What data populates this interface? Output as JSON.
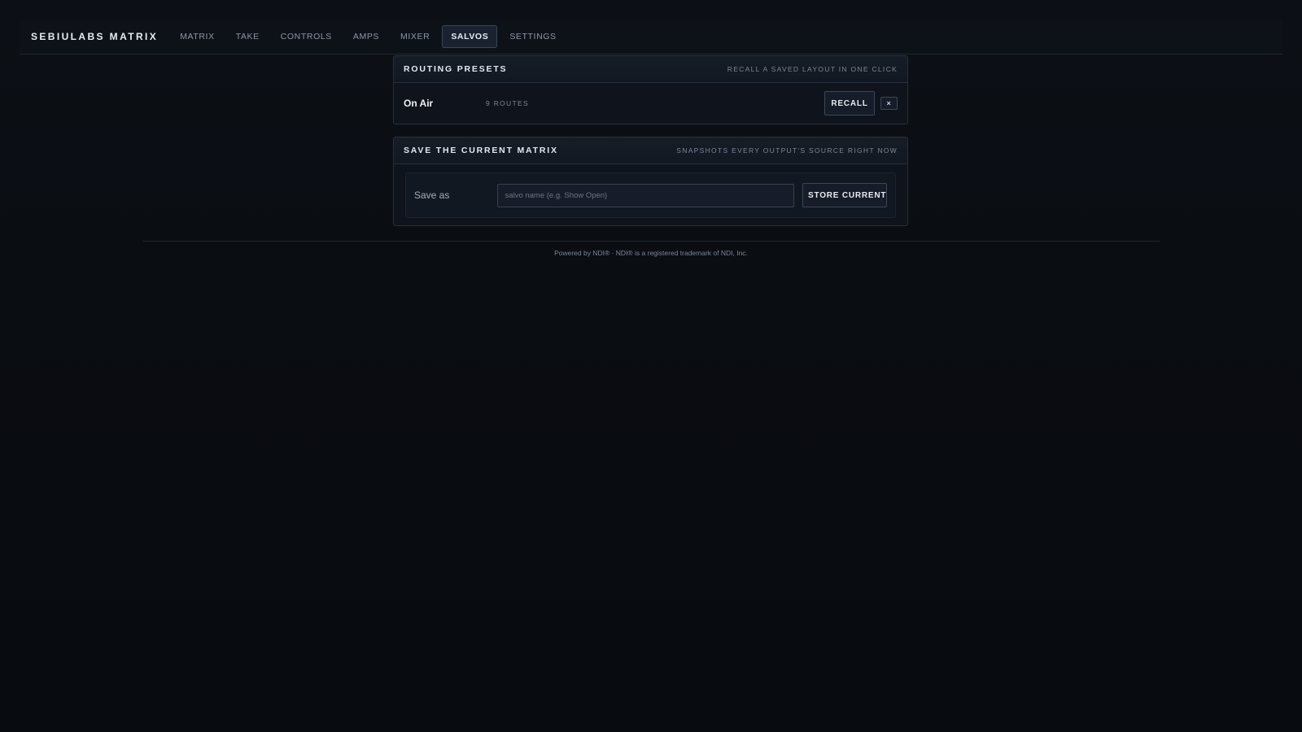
{
  "app": {
    "brand": "SEBIULABS MATRIX"
  },
  "nav": {
    "items": [
      {
        "label": "MATRIX",
        "active": false
      },
      {
        "label": "TAKE",
        "active": false
      },
      {
        "label": "CONTROLS",
        "active": false
      },
      {
        "label": "AMPS",
        "active": false
      },
      {
        "label": "MIXER",
        "active": false
      },
      {
        "label": "SALVOS",
        "active": true
      },
      {
        "label": "SETTINGS",
        "active": false
      }
    ]
  },
  "presets": {
    "title": "ROUTING PRESETS",
    "hint": "RECALL A SAVED LAYOUT IN ONE CLICK",
    "items": [
      {
        "name": "On Air",
        "routes": "9 ROUTES",
        "recall_label": "RECALL",
        "delete_label": "×"
      }
    ]
  },
  "save": {
    "title": "SAVE THE CURRENT MATRIX",
    "hint": "SNAPSHOTS EVERY OUTPUT'S SOURCE RIGHT NOW",
    "label": "Save as",
    "input_value": "",
    "placeholder": "salvo name (e.g. Show Open)",
    "button_label": "STORE CURRENT"
  },
  "footer": {
    "text": "Powered by NDI® · NDI® is a registered trademark of NDI, Inc."
  },
  "colors": {
    "background": "#0a0d12",
    "panel": "#0f141c",
    "border": "#262f3c",
    "text": "#e8ecf2",
    "muted": "#7b8696"
  }
}
